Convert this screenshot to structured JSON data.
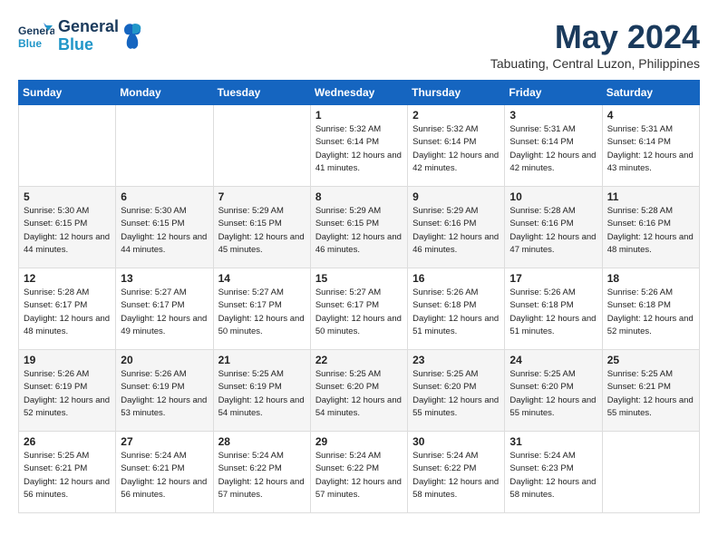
{
  "header": {
    "logo_general": "General",
    "logo_blue": "Blue",
    "month_title": "May 2024",
    "location": "Tabuating, Central Luzon, Philippines"
  },
  "weekdays": [
    "Sunday",
    "Monday",
    "Tuesday",
    "Wednesday",
    "Thursday",
    "Friday",
    "Saturday"
  ],
  "weeks": [
    [
      {
        "day": "",
        "sunrise": "",
        "sunset": "",
        "daylight": ""
      },
      {
        "day": "",
        "sunrise": "",
        "sunset": "",
        "daylight": ""
      },
      {
        "day": "",
        "sunrise": "",
        "sunset": "",
        "daylight": ""
      },
      {
        "day": "1",
        "sunrise": "Sunrise: 5:32 AM",
        "sunset": "Sunset: 6:14 PM",
        "daylight": "Daylight: 12 hours and 41 minutes."
      },
      {
        "day": "2",
        "sunrise": "Sunrise: 5:32 AM",
        "sunset": "Sunset: 6:14 PM",
        "daylight": "Daylight: 12 hours and 42 minutes."
      },
      {
        "day": "3",
        "sunrise": "Sunrise: 5:31 AM",
        "sunset": "Sunset: 6:14 PM",
        "daylight": "Daylight: 12 hours and 42 minutes."
      },
      {
        "day": "4",
        "sunrise": "Sunrise: 5:31 AM",
        "sunset": "Sunset: 6:14 PM",
        "daylight": "Daylight: 12 hours and 43 minutes."
      }
    ],
    [
      {
        "day": "5",
        "sunrise": "Sunrise: 5:30 AM",
        "sunset": "Sunset: 6:15 PM",
        "daylight": "Daylight: 12 hours and 44 minutes."
      },
      {
        "day": "6",
        "sunrise": "Sunrise: 5:30 AM",
        "sunset": "Sunset: 6:15 PM",
        "daylight": "Daylight: 12 hours and 44 minutes."
      },
      {
        "day": "7",
        "sunrise": "Sunrise: 5:29 AM",
        "sunset": "Sunset: 6:15 PM",
        "daylight": "Daylight: 12 hours and 45 minutes."
      },
      {
        "day": "8",
        "sunrise": "Sunrise: 5:29 AM",
        "sunset": "Sunset: 6:15 PM",
        "daylight": "Daylight: 12 hours and 46 minutes."
      },
      {
        "day": "9",
        "sunrise": "Sunrise: 5:29 AM",
        "sunset": "Sunset: 6:16 PM",
        "daylight": "Daylight: 12 hours and 46 minutes."
      },
      {
        "day": "10",
        "sunrise": "Sunrise: 5:28 AM",
        "sunset": "Sunset: 6:16 PM",
        "daylight": "Daylight: 12 hours and 47 minutes."
      },
      {
        "day": "11",
        "sunrise": "Sunrise: 5:28 AM",
        "sunset": "Sunset: 6:16 PM",
        "daylight": "Daylight: 12 hours and 48 minutes."
      }
    ],
    [
      {
        "day": "12",
        "sunrise": "Sunrise: 5:28 AM",
        "sunset": "Sunset: 6:17 PM",
        "daylight": "Daylight: 12 hours and 48 minutes."
      },
      {
        "day": "13",
        "sunrise": "Sunrise: 5:27 AM",
        "sunset": "Sunset: 6:17 PM",
        "daylight": "Daylight: 12 hours and 49 minutes."
      },
      {
        "day": "14",
        "sunrise": "Sunrise: 5:27 AM",
        "sunset": "Sunset: 6:17 PM",
        "daylight": "Daylight: 12 hours and 50 minutes."
      },
      {
        "day": "15",
        "sunrise": "Sunrise: 5:27 AM",
        "sunset": "Sunset: 6:17 PM",
        "daylight": "Daylight: 12 hours and 50 minutes."
      },
      {
        "day": "16",
        "sunrise": "Sunrise: 5:26 AM",
        "sunset": "Sunset: 6:18 PM",
        "daylight": "Daylight: 12 hours and 51 minutes."
      },
      {
        "day": "17",
        "sunrise": "Sunrise: 5:26 AM",
        "sunset": "Sunset: 6:18 PM",
        "daylight": "Daylight: 12 hours and 51 minutes."
      },
      {
        "day": "18",
        "sunrise": "Sunrise: 5:26 AM",
        "sunset": "Sunset: 6:18 PM",
        "daylight": "Daylight: 12 hours and 52 minutes."
      }
    ],
    [
      {
        "day": "19",
        "sunrise": "Sunrise: 5:26 AM",
        "sunset": "Sunset: 6:19 PM",
        "daylight": "Daylight: 12 hours and 52 minutes."
      },
      {
        "day": "20",
        "sunrise": "Sunrise: 5:26 AM",
        "sunset": "Sunset: 6:19 PM",
        "daylight": "Daylight: 12 hours and 53 minutes."
      },
      {
        "day": "21",
        "sunrise": "Sunrise: 5:25 AM",
        "sunset": "Sunset: 6:19 PM",
        "daylight": "Daylight: 12 hours and 54 minutes."
      },
      {
        "day": "22",
        "sunrise": "Sunrise: 5:25 AM",
        "sunset": "Sunset: 6:20 PM",
        "daylight": "Daylight: 12 hours and 54 minutes."
      },
      {
        "day": "23",
        "sunrise": "Sunrise: 5:25 AM",
        "sunset": "Sunset: 6:20 PM",
        "daylight": "Daylight: 12 hours and 55 minutes."
      },
      {
        "day": "24",
        "sunrise": "Sunrise: 5:25 AM",
        "sunset": "Sunset: 6:20 PM",
        "daylight": "Daylight: 12 hours and 55 minutes."
      },
      {
        "day": "25",
        "sunrise": "Sunrise: 5:25 AM",
        "sunset": "Sunset: 6:21 PM",
        "daylight": "Daylight: 12 hours and 55 minutes."
      }
    ],
    [
      {
        "day": "26",
        "sunrise": "Sunrise: 5:25 AM",
        "sunset": "Sunset: 6:21 PM",
        "daylight": "Daylight: 12 hours and 56 minutes."
      },
      {
        "day": "27",
        "sunrise": "Sunrise: 5:24 AM",
        "sunset": "Sunset: 6:21 PM",
        "daylight": "Daylight: 12 hours and 56 minutes."
      },
      {
        "day": "28",
        "sunrise": "Sunrise: 5:24 AM",
        "sunset": "Sunset: 6:22 PM",
        "daylight": "Daylight: 12 hours and 57 minutes."
      },
      {
        "day": "29",
        "sunrise": "Sunrise: 5:24 AM",
        "sunset": "Sunset: 6:22 PM",
        "daylight": "Daylight: 12 hours and 57 minutes."
      },
      {
        "day": "30",
        "sunrise": "Sunrise: 5:24 AM",
        "sunset": "Sunset: 6:22 PM",
        "daylight": "Daylight: 12 hours and 58 minutes."
      },
      {
        "day": "31",
        "sunrise": "Sunrise: 5:24 AM",
        "sunset": "Sunset: 6:23 PM",
        "daylight": "Daylight: 12 hours and 58 minutes."
      },
      {
        "day": "",
        "sunrise": "",
        "sunset": "",
        "daylight": ""
      }
    ]
  ]
}
